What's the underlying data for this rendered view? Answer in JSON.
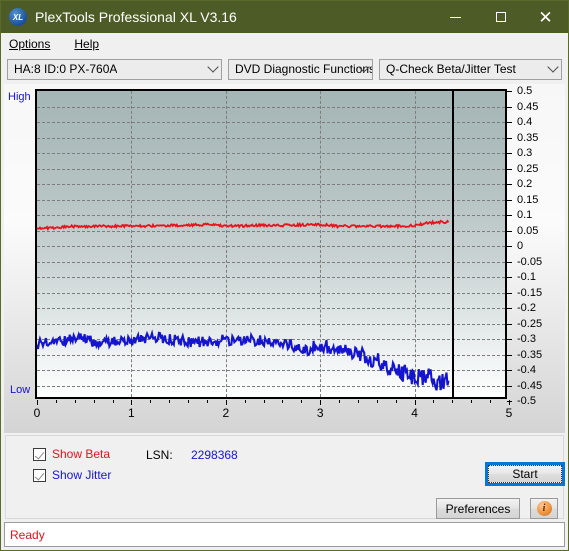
{
  "window": {
    "title": "PlexTools Professional XL V3.16",
    "app_icon": "xl-logo-icon",
    "minimize_label": "Minimize",
    "maximize_label": "Maximize",
    "close_label": "✕"
  },
  "menubar": {
    "items": [
      {
        "label": "Options",
        "accel": "O"
      },
      {
        "label": "Help",
        "accel": "H"
      }
    ]
  },
  "toolbar": {
    "drive_select": "HA:8 ID:0  PX-760A",
    "function_select": "DVD Diagnostic Functions",
    "test_select": "Q-Check Beta/Jitter Test"
  },
  "chart_labels": {
    "high": "High",
    "low": "Low"
  },
  "controls": {
    "show_beta_label": "Show Beta",
    "show_beta_checked": true,
    "show_jitter_label": "Show Jitter",
    "show_jitter_checked": true,
    "lsn_label": "LSN:",
    "lsn_value": "2298368",
    "start_label": "Start",
    "preferences_label": "Preferences",
    "info_label": "i"
  },
  "statusbar": {
    "text": "Ready"
  },
  "colors": {
    "beta": "#e8131d",
    "jitter": "#1515cf",
    "title_bar": "#4d5c26",
    "focus": "#0078d7",
    "status": "#e8131d"
  },
  "chart_data": {
    "type": "line",
    "title": "Q-Check Beta/Jitter Test",
    "xlabel": "",
    "ylabel": "",
    "xlim": [
      0,
      5
    ],
    "ylim": [
      -0.5,
      0.5
    ],
    "xticks": [
      0,
      1,
      2,
      3,
      4,
      5
    ],
    "yticks": [
      0.5,
      0.45,
      0.4,
      0.35,
      0.3,
      0.25,
      0.2,
      0.15,
      0.1,
      0.05,
      0,
      -0.05,
      -0.1,
      -0.15,
      -0.2,
      -0.25,
      -0.3,
      -0.35,
      -0.4,
      -0.45,
      -0.5
    ],
    "grid": true,
    "grid_style": "dashed-horizontal",
    "legend": [
      "Show Beta",
      "Show Jitter"
    ],
    "legend_position": "below-left",
    "data_end_x": 4.4,
    "axis_side_labels": {
      "top_left": "High",
      "bottom_left": "Low"
    },
    "series": [
      {
        "name": "Beta",
        "color": "#e8131d",
        "x": [
          0.0,
          0.1,
          0.2,
          0.3,
          0.4,
          0.5,
          0.6,
          0.7,
          0.8,
          0.9,
          1.0,
          1.1,
          1.2,
          1.3,
          1.4,
          1.5,
          1.6,
          1.7,
          1.8,
          1.9,
          2.0,
          2.1,
          2.2,
          2.3,
          2.4,
          2.5,
          2.6,
          2.7,
          2.8,
          2.9,
          3.0,
          3.1,
          3.2,
          3.3,
          3.4,
          3.5,
          3.6,
          3.7,
          3.8,
          3.9,
          4.0,
          4.1,
          4.2,
          4.3,
          4.4
        ],
        "values": [
          0.052,
          0.052,
          0.053,
          0.056,
          0.058,
          0.058,
          0.058,
          0.058,
          0.058,
          0.058,
          0.059,
          0.059,
          0.059,
          0.06,
          0.06,
          0.061,
          0.062,
          0.062,
          0.063,
          0.063,
          0.059,
          0.059,
          0.059,
          0.06,
          0.061,
          0.061,
          0.061,
          0.062,
          0.062,
          0.062,
          0.063,
          0.063,
          0.058,
          0.058,
          0.058,
          0.058,
          0.058,
          0.058,
          0.058,
          0.059,
          0.06,
          0.065,
          0.069,
          0.072,
          0.072
        ],
        "noise_amplitude": 0.004
      },
      {
        "name": "Jitter",
        "color": "#1515cf",
        "x": [
          0.0,
          0.1,
          0.2,
          0.3,
          0.4,
          0.5,
          0.6,
          0.7,
          0.8,
          0.9,
          1.0,
          1.1,
          1.2,
          1.3,
          1.4,
          1.5,
          1.6,
          1.7,
          1.8,
          1.9,
          2.0,
          2.1,
          2.2,
          2.3,
          2.4,
          2.5,
          2.6,
          2.7,
          2.8,
          2.9,
          3.0,
          3.1,
          3.2,
          3.3,
          3.4,
          3.5,
          3.6,
          3.7,
          3.8,
          3.9,
          4.0,
          4.1,
          4.2,
          4.3,
          4.4
        ],
        "values": [
          -0.33,
          -0.322,
          -0.318,
          -0.312,
          -0.308,
          -0.312,
          -0.318,
          -0.32,
          -0.318,
          -0.316,
          -0.314,
          -0.312,
          -0.31,
          -0.308,
          -0.31,
          -0.314,
          -0.318,
          -0.32,
          -0.318,
          -0.316,
          -0.314,
          -0.312,
          -0.312,
          -0.314,
          -0.316,
          -0.318,
          -0.322,
          -0.33,
          -0.338,
          -0.346,
          -0.33,
          -0.336,
          -0.344,
          -0.352,
          -0.36,
          -0.368,
          -0.378,
          -0.392,
          -0.408,
          -0.42,
          -0.428,
          -0.432,
          -0.44,
          -0.448,
          -0.456
        ],
        "noise_amplitude": 0.018
      }
    ]
  }
}
